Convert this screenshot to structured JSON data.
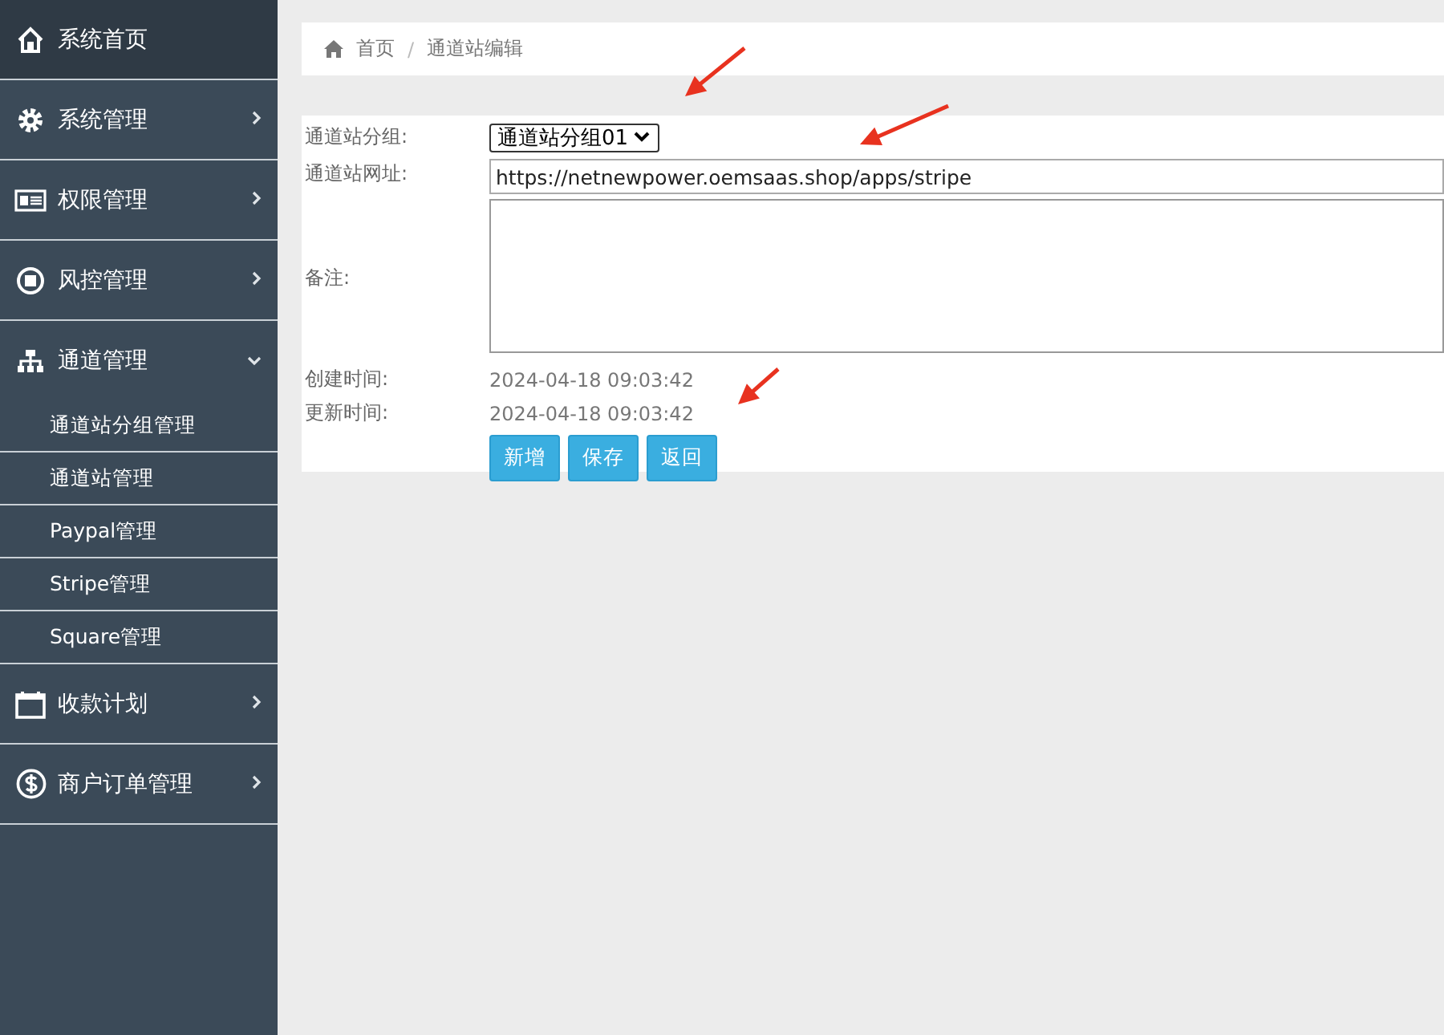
{
  "sidebar": {
    "items": [
      {
        "label": "系统首页",
        "selected": true
      },
      {
        "label": "系统管理",
        "selected": false,
        "expanded": false
      },
      {
        "label": "权限管理",
        "selected": false,
        "expanded": false
      },
      {
        "label": "风控管理",
        "selected": false,
        "expanded": false
      },
      {
        "label": "通道管理",
        "selected": false,
        "expanded": true,
        "children": [
          {
            "label": "通道站分组管理",
            "selected": false
          },
          {
            "label": "通道站管理",
            "selected": false
          },
          {
            "label": "Paypal管理",
            "selected": false
          },
          {
            "label": "Stripe管理",
            "selected": false
          },
          {
            "label": "Square管理",
            "selected": false
          }
        ]
      },
      {
        "label": "收款计划",
        "selected": false,
        "expanded": false
      },
      {
        "label": "商户订单管理",
        "selected": false,
        "expanded": false
      }
    ]
  },
  "breadcrumb": {
    "home": "首页",
    "separator": "/",
    "current": "通道站编辑"
  },
  "form": {
    "group": {
      "label": "通道站分组:",
      "value": "通道站分组01"
    },
    "url": {
      "label": "通道站网址:",
      "value": "https://netnewpower.oemsaas.shop/apps/stripe"
    },
    "note": {
      "label": "备注:"
    },
    "created": {
      "label": "创建时间:",
      "value": "2024-04-18 09:03:42"
    },
    "updated": {
      "label": "更新时间:",
      "value": "2024-04-18 09:03:42"
    },
    "buttons": [
      "新增",
      "保存",
      "返回"
    ]
  }
}
